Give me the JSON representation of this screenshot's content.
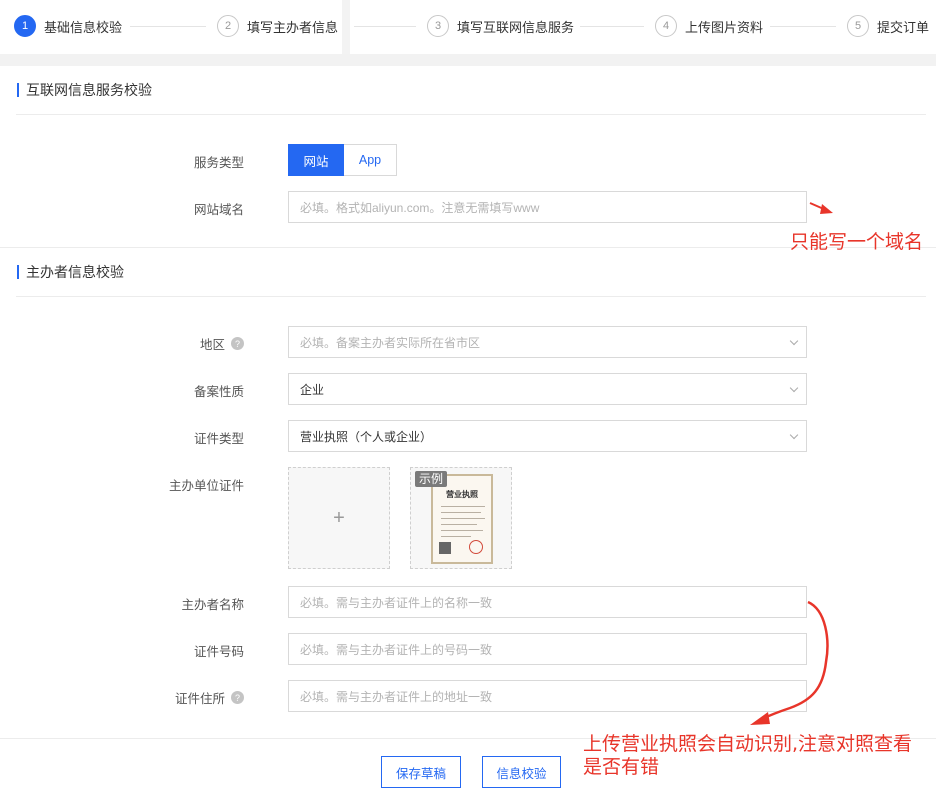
{
  "stepper": {
    "steps": [
      {
        "num": "1",
        "label": "基础信息校验"
      },
      {
        "num": "2",
        "label": "填写主办者信息"
      },
      {
        "num": "3",
        "label": "填写互联网信息服务"
      },
      {
        "num": "4",
        "label": "上传图片资料"
      },
      {
        "num": "5",
        "label": "提交订单"
      }
    ]
  },
  "section1": {
    "title": "互联网信息服务校验",
    "service_type_label": "服务类型",
    "service_type_options": [
      "网站",
      "App"
    ],
    "domain_label": "网站域名",
    "domain_placeholder": "必填。格式如aliyun.com。注意无需填写www"
  },
  "section2": {
    "title": "主办者信息校验",
    "region_label": "地区",
    "region_placeholder": "必填。备案主办者实际所在省市区",
    "nature_label": "备案性质",
    "nature_value": "企业",
    "cert_type_label": "证件类型",
    "cert_type_value": "营业执照（个人或企业）",
    "cert_label": "主办单位证件",
    "upload_plus": "+",
    "sample_tag": "示例",
    "sample_doc_title": "营业执照",
    "name_label": "主办者名称",
    "name_placeholder": "必填。需与主办者证件上的名称一致",
    "cert_no_label": "证件号码",
    "cert_no_placeholder": "必填。需与主办者证件上的号码一致",
    "address_label": "证件住所",
    "address_placeholder": "必填。需与主办者证件上的地址一致"
  },
  "actions": {
    "save_draft": "保存草稿",
    "verify": "信息校验"
  },
  "annotations": {
    "domain_note": "只能写一个域名",
    "license_note": "上传营业执照会自动识别,注意对照查看是否有错"
  },
  "colors": {
    "primary": "#2468f2",
    "annotation": "#e8352a"
  }
}
